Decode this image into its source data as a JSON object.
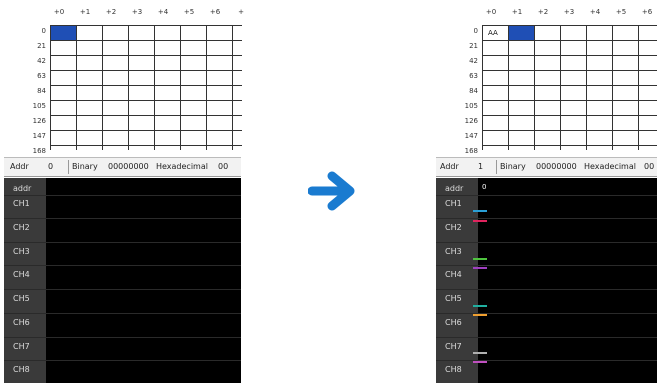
{
  "column_headers": [
    "+0",
    "+1",
    "+2",
    "+3",
    "+4",
    "+5",
    "+6",
    "+"
  ],
  "row_labels": [
    "0",
    "21",
    "42",
    "63",
    "84",
    "105",
    "126",
    "147",
    "168"
  ],
  "left": {
    "addr_label": "Addr",
    "addr_value": "0",
    "binary_label": "Binary",
    "binary_value": "00000000",
    "hex_label": "Hexadecimal",
    "hex_value": "00"
  },
  "right": {
    "cell_value": "AA",
    "addr_label": "Addr",
    "addr_value": "1",
    "binary_label": "Binary",
    "binary_value": "00000000",
    "hex_label": "Hexadecimal",
    "hex_value": "00",
    "scope_addr_value": "0"
  },
  "channels": [
    "addr",
    "CH1",
    "CH2",
    "CH3",
    "CH4",
    "CH5",
    "CH6",
    "CH7",
    "CH8"
  ],
  "trace_colors": [
    "#2a9fd6",
    "#e0245e",
    "#4fc43f",
    "#a040c0",
    "#20b0a0",
    "#f0a030",
    "#b0b0b0",
    "#c050c0"
  ],
  "colors": {
    "selection": "#1f4fb5",
    "arrow": "#1a7bd0",
    "scope_background": "#000000",
    "label_column": "#3a3a3a"
  }
}
